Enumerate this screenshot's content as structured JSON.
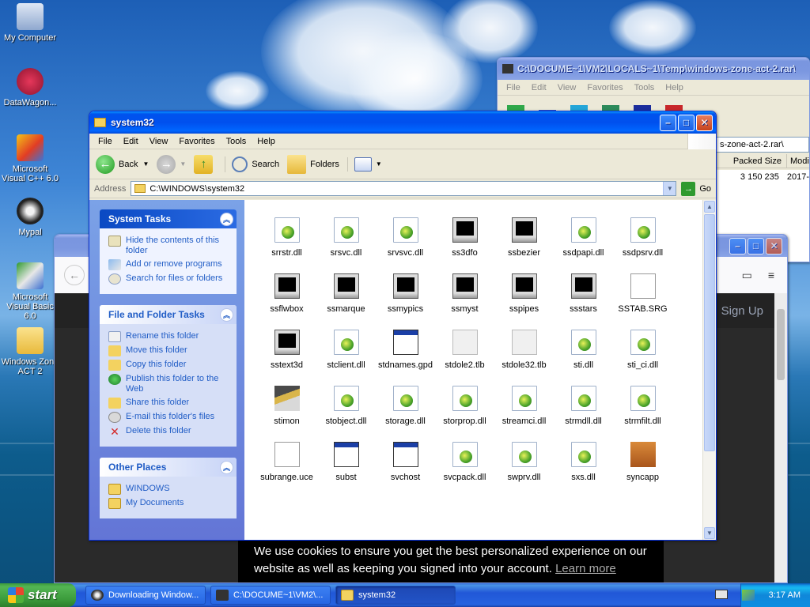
{
  "desktop": {
    "icons": [
      {
        "label": "My Computer"
      },
      {
        "label": "DataWagon..."
      },
      {
        "label": "Microsoft Visual C++ 6.0"
      },
      {
        "label": "Mypal"
      },
      {
        "label": "Microsoft Visual Basic 6.0"
      },
      {
        "label": "Windows Zone ACT 2"
      }
    ]
  },
  "winrar": {
    "title": "C:\\DOCUME~1\\VM2\\LOCALS~1\\Temp\\windows-zone-act-2.rar\\",
    "menu": [
      "File",
      "Edit",
      "View",
      "Favorites",
      "Tools",
      "Help"
    ],
    "path_fragment": "s-zone-act-2.rar\\",
    "columns": [
      "Packed Size",
      "Modi"
    ],
    "row": {
      "packed": "3 150 235",
      "modified": "2017-"
    }
  },
  "browser": {
    "signup": "Sign Up",
    "cookie_text": "We use cookies to ensure you get the best personalized experience on our website as well as keeping you signed into your account.",
    "cookie_link": "Learn more"
  },
  "explorer": {
    "title": "system32",
    "menu": [
      "File",
      "Edit",
      "View",
      "Favorites",
      "Tools",
      "Help"
    ],
    "toolbar": {
      "back": "Back",
      "search": "Search",
      "folders": "Folders"
    },
    "address_label": "Address",
    "address_value": "C:\\WINDOWS\\system32",
    "go": "Go",
    "system_tasks": {
      "title": "System Tasks",
      "items": [
        "Hide the contents of this folder",
        "Add or remove programs",
        "Search for files or folders"
      ]
    },
    "file_tasks": {
      "title": "File and Folder Tasks",
      "items": [
        "Rename this folder",
        "Move this folder",
        "Copy this folder",
        "Publish this folder to the Web",
        "Share this folder",
        "E-mail this folder's files",
        "Delete this folder"
      ]
    },
    "other_places": {
      "title": "Other Places",
      "items": [
        "WINDOWS",
        "My Documents"
      ]
    },
    "files": [
      {
        "name": "srrstr.dll",
        "icon": "dll"
      },
      {
        "name": "srsvc.dll",
        "icon": "dll"
      },
      {
        "name": "srvsvc.dll",
        "icon": "dll"
      },
      {
        "name": "ss3dfo",
        "icon": "screensaver"
      },
      {
        "name": "ssbezier",
        "icon": "screensaver"
      },
      {
        "name": "ssdpapi.dll",
        "icon": "dll"
      },
      {
        "name": "ssdpsrv.dll",
        "icon": "dll"
      },
      {
        "name": "ssflwbox",
        "icon": "screensaver"
      },
      {
        "name": "ssmarque",
        "icon": "screensaver"
      },
      {
        "name": "ssmypics",
        "icon": "screensaver"
      },
      {
        "name": "ssmyst",
        "icon": "screensaver"
      },
      {
        "name": "sspipes",
        "icon": "screensaver"
      },
      {
        "name": "ssstars",
        "icon": "screensaver"
      },
      {
        "name": "SSTAB.SRG",
        "icon": "document"
      },
      {
        "name": "sstext3d",
        "icon": "screensaver"
      },
      {
        "name": "stclient.dll",
        "icon": "dll"
      },
      {
        "name": "stdnames.gpd",
        "icon": "window"
      },
      {
        "name": "stdole2.tlb",
        "icon": "blank"
      },
      {
        "name": "stdole32.tlb",
        "icon": "blank"
      },
      {
        "name": "sti.dll",
        "icon": "dll"
      },
      {
        "name": "sti_ci.dll",
        "icon": "dll"
      },
      {
        "name": "stimon",
        "icon": "scanner"
      },
      {
        "name": "stobject.dll",
        "icon": "dll"
      },
      {
        "name": "storage.dll",
        "icon": "dll"
      },
      {
        "name": "storprop.dll",
        "icon": "dll"
      },
      {
        "name": "streamci.dll",
        "icon": "dll"
      },
      {
        "name": "strmdll.dll",
        "icon": "dll"
      },
      {
        "name": "strmfilt.dll",
        "icon": "dll"
      },
      {
        "name": "subrange.uce",
        "icon": "document"
      },
      {
        "name": "subst",
        "icon": "window"
      },
      {
        "name": "svchost",
        "icon": "window"
      },
      {
        "name": "svcpack.dll",
        "icon": "dll"
      },
      {
        "name": "swprv.dll",
        "icon": "dll"
      },
      {
        "name": "sxs.dll",
        "icon": "dll"
      },
      {
        "name": "syncapp",
        "icon": "briefcase"
      }
    ]
  },
  "taskbar": {
    "start": "start",
    "buttons": [
      "Downloading Window...",
      "C:\\DOCUME~1\\VM2\\...",
      "system32"
    ],
    "clock": "3:17 AM"
  }
}
